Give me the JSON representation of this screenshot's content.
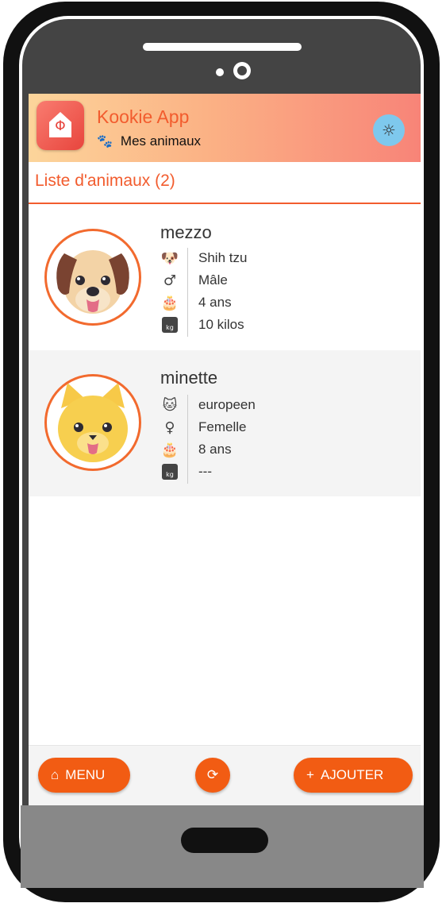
{
  "header": {
    "app_title": "Kookie App",
    "subtitle": "Mes animaux",
    "subtitle_icon": "paw-icon",
    "theme_icon": "sun-icon"
  },
  "list": {
    "title": "Liste d'animaux (2)",
    "pets": [
      {
        "name": "mezzo",
        "breed": "Shih tzu",
        "sex": "Mâle",
        "age": "4 ans",
        "weight": "10 kilos",
        "avatar": "dog-avatar"
      },
      {
        "name": "minette",
        "breed": "europeen",
        "sex": "Femelle",
        "age": "8 ans",
        "weight": "---",
        "avatar": "cat-avatar"
      }
    ]
  },
  "footer": {
    "menu_label": "MENU",
    "add_label": "AJOUTER"
  },
  "colors": {
    "accent": "#f25c13",
    "header_start": "#fcd59b",
    "header_end": "#f88478",
    "theme_button": "#7ec8ed"
  }
}
